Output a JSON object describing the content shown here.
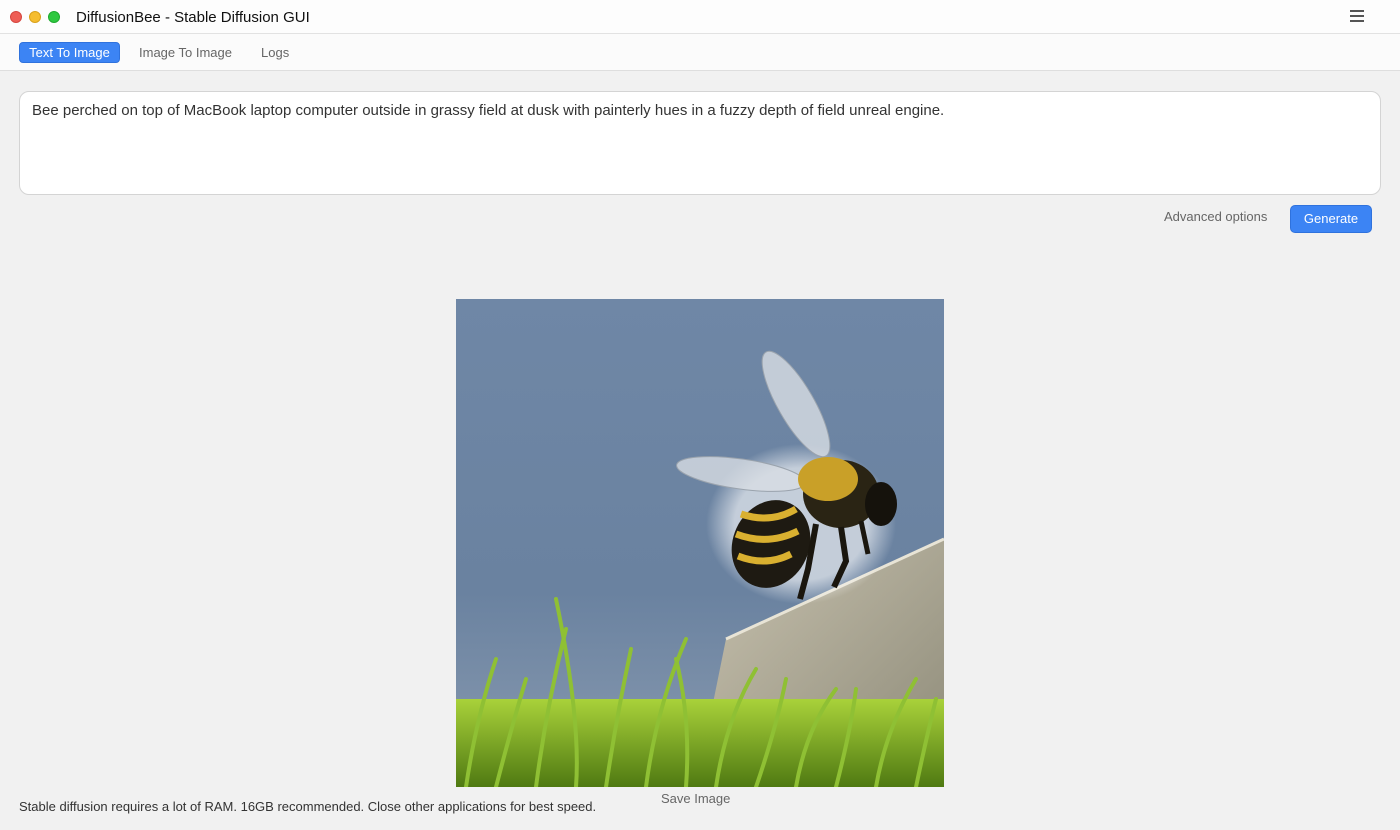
{
  "window": {
    "title": "DiffusionBee - Stable Diffusion GUI",
    "menu_icon": "hamburger-menu-icon"
  },
  "tabs": [
    {
      "label": "Text To Image",
      "active": true
    },
    {
      "label": "Image To Image",
      "active": false
    },
    {
      "label": "Logs",
      "active": false
    }
  ],
  "prompt": {
    "value": "Bee perched on top of MacBook laptop computer outside in grassy field at dusk with painterly hues in a fuzzy depth of field unreal engine."
  },
  "actions": {
    "advanced_label": "Advanced options",
    "generate_label": "Generate"
  },
  "result": {
    "image_icon": "generated-bee-image",
    "save_label": "Save Image"
  },
  "footer": {
    "text": "Stable diffusion requires a lot of RAM. 16GB recommended. Close other applications for best speed."
  },
  "colors": {
    "accent": "#3c84f4",
    "background": "#f1f1f1"
  }
}
